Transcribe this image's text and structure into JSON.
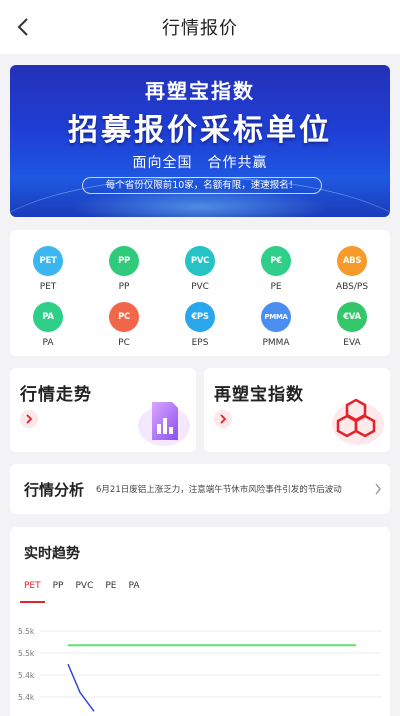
{
  "header": {
    "title": "行情报价"
  },
  "banner": {
    "title": "再塑宝指数",
    "headline": "招募报价采标单位",
    "subtitle": "面向全国　合作共赢",
    "note": "每个省份仅限前10家，名额有限，速速报名！"
  },
  "categories": [
    {
      "label": "PET",
      "icon_text": "PET",
      "icon": "pet-icon",
      "color": "#3bb6f0"
    },
    {
      "label": "PP",
      "icon_text": "PP",
      "icon": "pp-icon",
      "color": "#2fca7a"
    },
    {
      "label": "PVC",
      "icon_text": "PVC",
      "icon": "pvc-icon",
      "color": "#25c2c6"
    },
    {
      "label": "PE",
      "icon_text": "P€",
      "icon": "pe-icon",
      "color": "#2fcf8a"
    },
    {
      "label": "ABS/PS",
      "icon_text": "ABS",
      "icon": "abs-icon",
      "color": "#f59a2b"
    },
    {
      "label": "PA",
      "icon_text": "PA",
      "icon": "pa-icon",
      "color": "#2fcf8a"
    },
    {
      "label": "PC",
      "icon_text": "PC",
      "icon": "pc-icon",
      "color": "#f2674a"
    },
    {
      "label": "EPS",
      "icon_text": "€PS",
      "icon": "eps-icon",
      "color": "#2aa7ec"
    },
    {
      "label": "PMMA",
      "icon_text": "PMMA",
      "icon": "pmma-icon",
      "color": "#4a8ef2"
    },
    {
      "label": "EVA",
      "icon_text": "€VA",
      "icon": "eva-icon",
      "color": "#33c76a"
    }
  ],
  "cards": {
    "market_trend": {
      "title": "行情走势",
      "icon": "chart-document-icon"
    },
    "index": {
      "title": "再塑宝指数",
      "icon": "hexagon-cells-icon"
    }
  },
  "analysis": {
    "title": "行情分析",
    "text": "6月21日废铝上涨乏力，注意端午节休市风险事件引发的节后波动"
  },
  "trend": {
    "title": "实时趋势",
    "tabs": [
      "PET",
      "PP",
      "PVC",
      "PE",
      "PA"
    ],
    "active_tab": "PET"
  },
  "colors": {
    "accent": "#e2232c",
    "series_flat": "#5ee36b",
    "series_down": "#3347d6"
  },
  "chart_data": {
    "type": "line",
    "title": "",
    "ylabel": "",
    "xlabel": "",
    "y_tick_labels": [
      "5.5k",
      "5.5k",
      "5.4k",
      "5.4k"
    ],
    "ylim": [
      5350,
      5560
    ],
    "x": [
      0,
      1,
      2,
      3,
      4,
      5,
      6
    ],
    "series": [
      {
        "values": [
          5500,
          5500,
          5500,
          5500,
          5500,
          5500,
          5500
        ],
        "color": "#5ee36b"
      },
      {
        "values": [
          5460,
          5400,
          5360
        ],
        "color": "#3347d6"
      }
    ],
    "grid": true
  }
}
